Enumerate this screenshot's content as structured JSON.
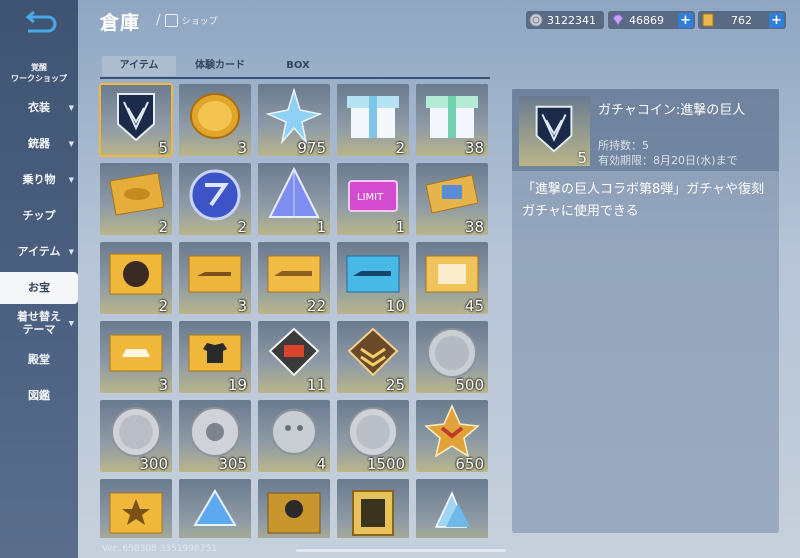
{
  "sidebar": {
    "items": [
      {
        "label": "覚醒",
        "label2": "ワークショップ"
      },
      {
        "label": "衣装"
      },
      {
        "label": "銃器"
      },
      {
        "label": "乗り物"
      },
      {
        "label": "チップ"
      },
      {
        "label": "アイテム"
      },
      {
        "label": "お宝"
      },
      {
        "label": "着せ替え",
        "label2": "テーマ"
      },
      {
        "label": "殿堂"
      },
      {
        "label": "図鑑"
      }
    ]
  },
  "header": {
    "title": "倉庫",
    "breadcrumb": "ショップ",
    "currencies": [
      {
        "icon": "silver-coin-icon",
        "value": "3122341"
      },
      {
        "icon": "diamond-icon",
        "value": "46869"
      },
      {
        "icon": "gold-ticket-icon",
        "value": "762"
      }
    ]
  },
  "tabs": [
    "アイテム",
    "体験カード",
    "BOX"
  ],
  "items": [
    {
      "name": "wings-emblem",
      "count": "5"
    },
    {
      "name": "gold-coin",
      "count": "3"
    },
    {
      "name": "blue-star",
      "count": "975"
    },
    {
      "name": "gift-box-blue",
      "count": "2"
    },
    {
      "name": "gift-box-green",
      "count": "38"
    },
    {
      "name": "gold-ticket-bike",
      "count": "2"
    },
    {
      "name": "blue-disc",
      "count": "2"
    },
    {
      "name": "crystal-pyramid",
      "count": "1"
    },
    {
      "name": "limit-card",
      "count": "1",
      "text": "LIMIT"
    },
    {
      "name": "gold-ticket-card",
      "count": "38"
    },
    {
      "name": "gold-ticket-character",
      "count": "2"
    },
    {
      "name": "gold-ticket-rifle",
      "count": "3"
    },
    {
      "name": "gold-ticket-rifle-2",
      "count": "22"
    },
    {
      "name": "blue-ticket-rifle",
      "count": "10"
    },
    {
      "name": "gold-ticket-frame",
      "count": "45"
    },
    {
      "name": "gold-ticket-car",
      "count": "3"
    },
    {
      "name": "gold-ticket-shirt",
      "count": "19"
    },
    {
      "name": "rank-badge-red",
      "count": "11"
    },
    {
      "name": "rank-badge-gold",
      "count": "25"
    },
    {
      "name": "silver-medal-1",
      "count": "500"
    },
    {
      "name": "silver-medal-2",
      "count": "300"
    },
    {
      "name": "silver-medal-3",
      "count": "305"
    },
    {
      "name": "silver-medal-4",
      "count": "4"
    },
    {
      "name": "silver-medal-5",
      "count": "1500"
    },
    {
      "name": "gold-chevron-badge",
      "count": "650"
    },
    {
      "name": "gold-ticket-star",
      "count": ""
    },
    {
      "name": "blue-crystal-shard",
      "count": ""
    },
    {
      "name": "cosmo-ticket",
      "count": ""
    },
    {
      "name": "gold-frame",
      "count": ""
    },
    {
      "name": "crystal-cluster",
      "count": ""
    }
  ],
  "detail": {
    "name": "ガチャコイン:進撃の巨人",
    "owned": "所持数：5",
    "expiry": "有効期限：8月20日(水)まで",
    "count": "5",
    "description": "「進撃の巨人コラボ第8弾」ガチャや復刻ガチャに使用できる"
  },
  "version": "Ver: 650308 3351998751"
}
